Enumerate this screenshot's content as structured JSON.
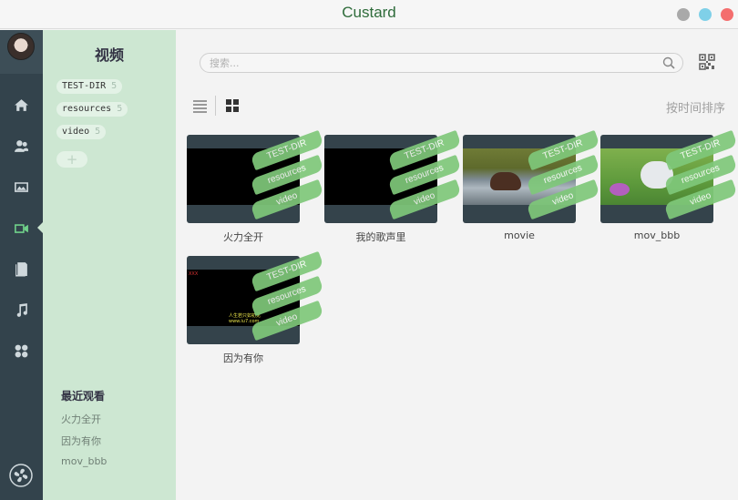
{
  "window": {
    "title": "Custard"
  },
  "sidebar": {
    "heading": "视频",
    "tags": [
      {
        "name": "TEST-DIR",
        "count": "5"
      },
      {
        "name": "resources",
        "count": "5"
      },
      {
        "name": "video",
        "count": "5"
      }
    ],
    "add_tag_label": "+",
    "recent_title": "最近观看",
    "recent_items": [
      "火力全开",
      "因为有你",
      "mov_bbb"
    ]
  },
  "toolbar": {
    "search_placeholder": "搜索...",
    "sort_label": "按时间排序"
  },
  "videos": [
    {
      "name": "火力全开",
      "tags": [
        "TEST-DIR",
        "resources",
        "video"
      ]
    },
    {
      "name": "我的歌声里",
      "tags": [
        "TEST-DIR",
        "resources",
        "video"
      ]
    },
    {
      "name": "movie",
      "tags": [
        "TEST-DIR",
        "resources",
        "video"
      ]
    },
    {
      "name": "mov_bbb",
      "tags": [
        "TEST-DIR",
        "resources",
        "video"
      ]
    },
    {
      "name": "因为有你",
      "tags": [
        "TEST-DIR",
        "resources",
        "video"
      ],
      "caption": "人生若只如初见\nwww.iu7.com",
      "logo": "XXX"
    }
  ],
  "colors": {
    "accent": "#6fd089",
    "rail_bg": "#33434c",
    "panel_bg": "#cde7d2",
    "tag_ribbon": "#7fc87a",
    "title_text": "#2e6b3a"
  },
  "icons": {
    "rail": [
      "home-icon",
      "people-icon",
      "image-icon",
      "video-icon",
      "document-icon",
      "music-icon",
      "apps-icon"
    ],
    "footer": "fan-icon",
    "search": "search-icon",
    "qr": "qr-code-icon",
    "views": [
      "list-view-icon",
      "grid-view-icon"
    ]
  }
}
